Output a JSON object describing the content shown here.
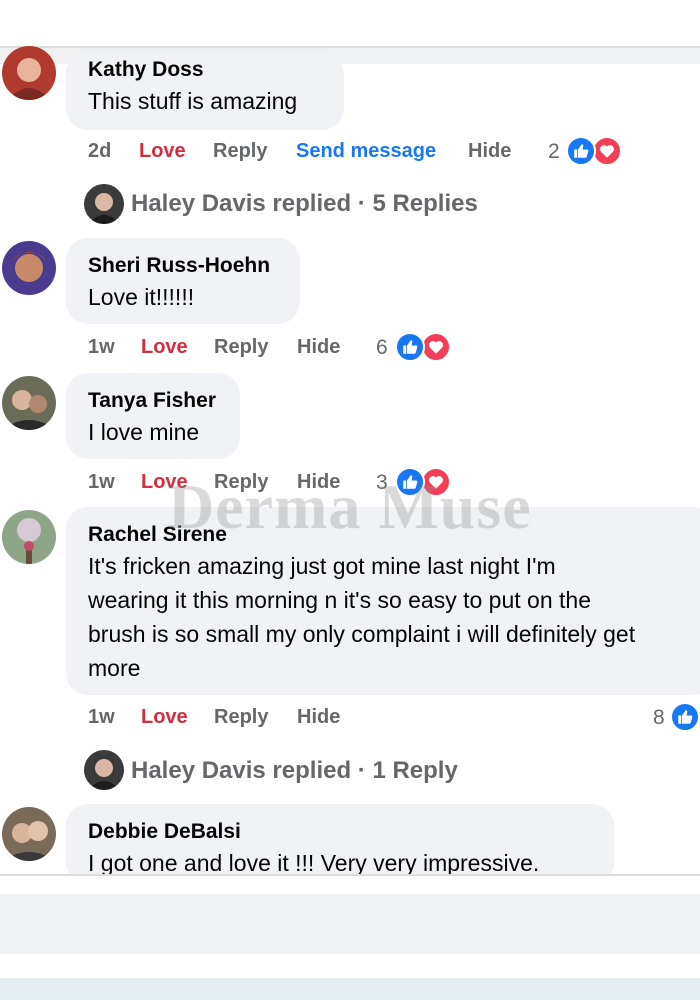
{
  "watermark": "Derma Muse",
  "colors": {
    "love": "#d32e3f",
    "link": "#1877f2",
    "meta": "#65676b",
    "bubble": "#f0f2f5"
  },
  "comments": [
    {
      "author": "Kathy Doss",
      "lines": [
        "This stuff is amazing"
      ],
      "time": "2d",
      "love": "Love",
      "reply": "Reply",
      "send": "Send message",
      "hide": "Hide",
      "reactions": "2",
      "reaction_icons": [
        "like-icon",
        "heart-icon"
      ]
    },
    {
      "author": "Sheri Russ-Hoehn",
      "lines": [
        "Love it!!!!!!"
      ],
      "time": "1w",
      "love": "Love",
      "reply": "Reply",
      "hide": "Hide",
      "reactions": "6",
      "reaction_icons": [
        "like-icon",
        "heart-icon"
      ]
    },
    {
      "author": "Tanya Fisher",
      "lines": [
        "I love mine"
      ],
      "time": "1w",
      "love": "Love",
      "reply": "Reply",
      "hide": "Hide",
      "reactions": "3",
      "reaction_icons": [
        "like-icon",
        "heart-icon"
      ]
    },
    {
      "author": "Rachel Sirene",
      "lines": [
        "It's fricken amazing just got mine last night I'm",
        "wearing it this morning n it's so easy to put on the",
        "brush is so small my only complaint i will definitely get",
        "more"
      ],
      "time": "1w",
      "love": "Love",
      "reply": "Reply",
      "hide": "Hide",
      "reactions": "8",
      "reaction_icons": [
        "like-icon"
      ]
    },
    {
      "author": "Debbie DeBalsi",
      "lines": [
        "I got one and love it !!! Very very impressive."
      ]
    }
  ],
  "replies": [
    {
      "text": "Haley Davis replied · 5 Replies"
    },
    {
      "text": "Haley Davis replied · 1 Reply"
    }
  ]
}
